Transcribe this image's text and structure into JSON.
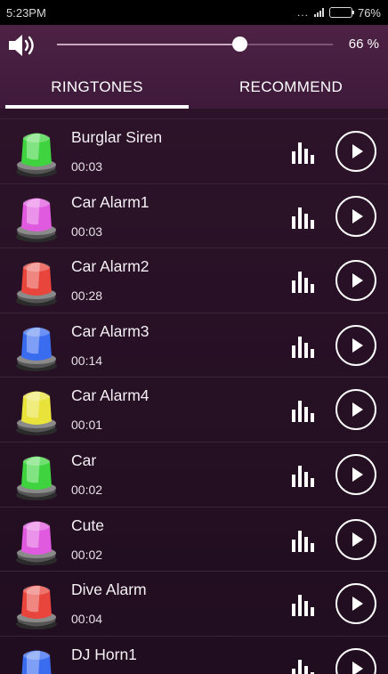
{
  "status_bar": {
    "time": "5:23PM",
    "dots": "...",
    "battery": "76%",
    "battery_level": 0.76
  },
  "volume": {
    "percent_label": "66 %",
    "level": 0.66
  },
  "tabs": [
    {
      "label": "RINGTONES",
      "active": true
    },
    {
      "label": "RECOMMEND",
      "active": false
    }
  ],
  "ringtones": [
    {
      "name": "Burglar Siren",
      "duration": "00:03",
      "color": "#3fd43f"
    },
    {
      "name": "Car Alarm1",
      "duration": "00:03",
      "color": "#e05ae0"
    },
    {
      "name": "Car Alarm2",
      "duration": "00:28",
      "color": "#e8453c"
    },
    {
      "name": "Car Alarm3",
      "duration": "00:14",
      "color": "#3a6cf0"
    },
    {
      "name": "Car Alarm4",
      "duration": "00:01",
      "color": "#e8e23a"
    },
    {
      "name": "Car",
      "duration": "00:02",
      "color": "#3fd43f"
    },
    {
      "name": "Cute",
      "duration": "00:02",
      "color": "#e05ae0"
    },
    {
      "name": "Dive Alarm",
      "duration": "00:04",
      "color": "#e8453c"
    },
    {
      "name": "DJ Horn1",
      "duration": "",
      "color": "#3a6cf0"
    }
  ],
  "icons": {
    "speaker": "speaker-icon",
    "signal": "signal-icon",
    "battery": "battery-icon",
    "siren": "siren-icon",
    "equalizer": "equalizer-icon",
    "play": "play-icon"
  }
}
